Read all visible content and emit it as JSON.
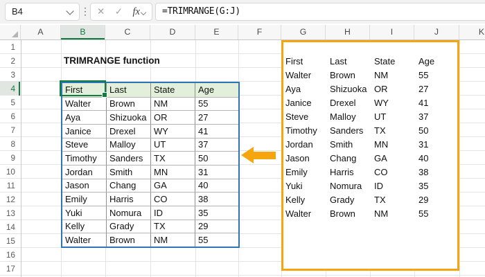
{
  "formula_bar": {
    "name_box_value": "B4",
    "formula": "=TRIMRANGE(G:J)",
    "icons": {
      "cancel": "✕",
      "enter": "✓",
      "insert_function": "fx",
      "more": "⋮"
    }
  },
  "sheet": {
    "column_headers": [
      "A",
      "B",
      "C",
      "D",
      "E",
      "F",
      "G",
      "H",
      "I",
      "J",
      "K"
    ],
    "row_headers": [
      "1",
      "2",
      "3",
      "4",
      "5",
      "6",
      "7",
      "8",
      "9",
      "10",
      "11",
      "12",
      "13",
      "14",
      "15",
      "16",
      "17"
    ],
    "selected_column": "B",
    "selected_row": "4"
  },
  "content": {
    "title": "TRIMRANGE function",
    "table": {
      "headers": [
        "First",
        "Last",
        "State",
        "Age"
      ],
      "rows": [
        [
          "Walter",
          "Brown",
          "NM",
          "55"
        ],
        [
          "Aya",
          "Shizuoka",
          "OR",
          "27"
        ],
        [
          "Janice",
          "Drexel",
          "WY",
          "41"
        ],
        [
          "Steve",
          "Malloy",
          "UT",
          "37"
        ],
        [
          "Timothy",
          "Sanders",
          "TX",
          "50"
        ],
        [
          "Jordan",
          "Smith",
          "MN",
          "31"
        ],
        [
          "Jason",
          "Chang",
          "GA",
          "40"
        ],
        [
          "Emily",
          "Harris",
          "CO",
          "38"
        ],
        [
          "Yuki",
          "Nomura",
          "ID",
          "35"
        ],
        [
          "Kelly",
          "Grady",
          "TX",
          "29"
        ],
        [
          "Walter",
          "Brown",
          "NM",
          "55"
        ]
      ]
    },
    "spill_range": {
      "headers": [
        "First",
        "Last",
        "State",
        "Age"
      ],
      "rows": [
        [
          "Walter",
          "Brown",
          "NM",
          "55"
        ],
        [
          "Aya",
          "Shizuoka",
          "OR",
          "27"
        ],
        [
          "Janice",
          "Drexel",
          "WY",
          "41"
        ],
        [
          "Steve",
          "Malloy",
          "UT",
          "37"
        ],
        [
          "Timothy",
          "Sanders",
          "TX",
          "50"
        ],
        [
          "Jordan",
          "Smith",
          "MN",
          "31"
        ],
        [
          "Jason",
          "Chang",
          "GA",
          "40"
        ],
        [
          "Emily",
          "Harris",
          "CO",
          "38"
        ],
        [
          "Yuki",
          "Nomura",
          "ID",
          "35"
        ],
        [
          "Kelly",
          "Grady",
          "TX",
          "29"
        ],
        [
          "Walter",
          "Brown",
          "NM",
          "55"
        ]
      ]
    }
  },
  "colors": {
    "accent_green": "#107C41",
    "range_highlight_orange": "#F5A50D",
    "table_border_blue": "#2E75B6",
    "table_header_fill": "#E2EFDA"
  }
}
